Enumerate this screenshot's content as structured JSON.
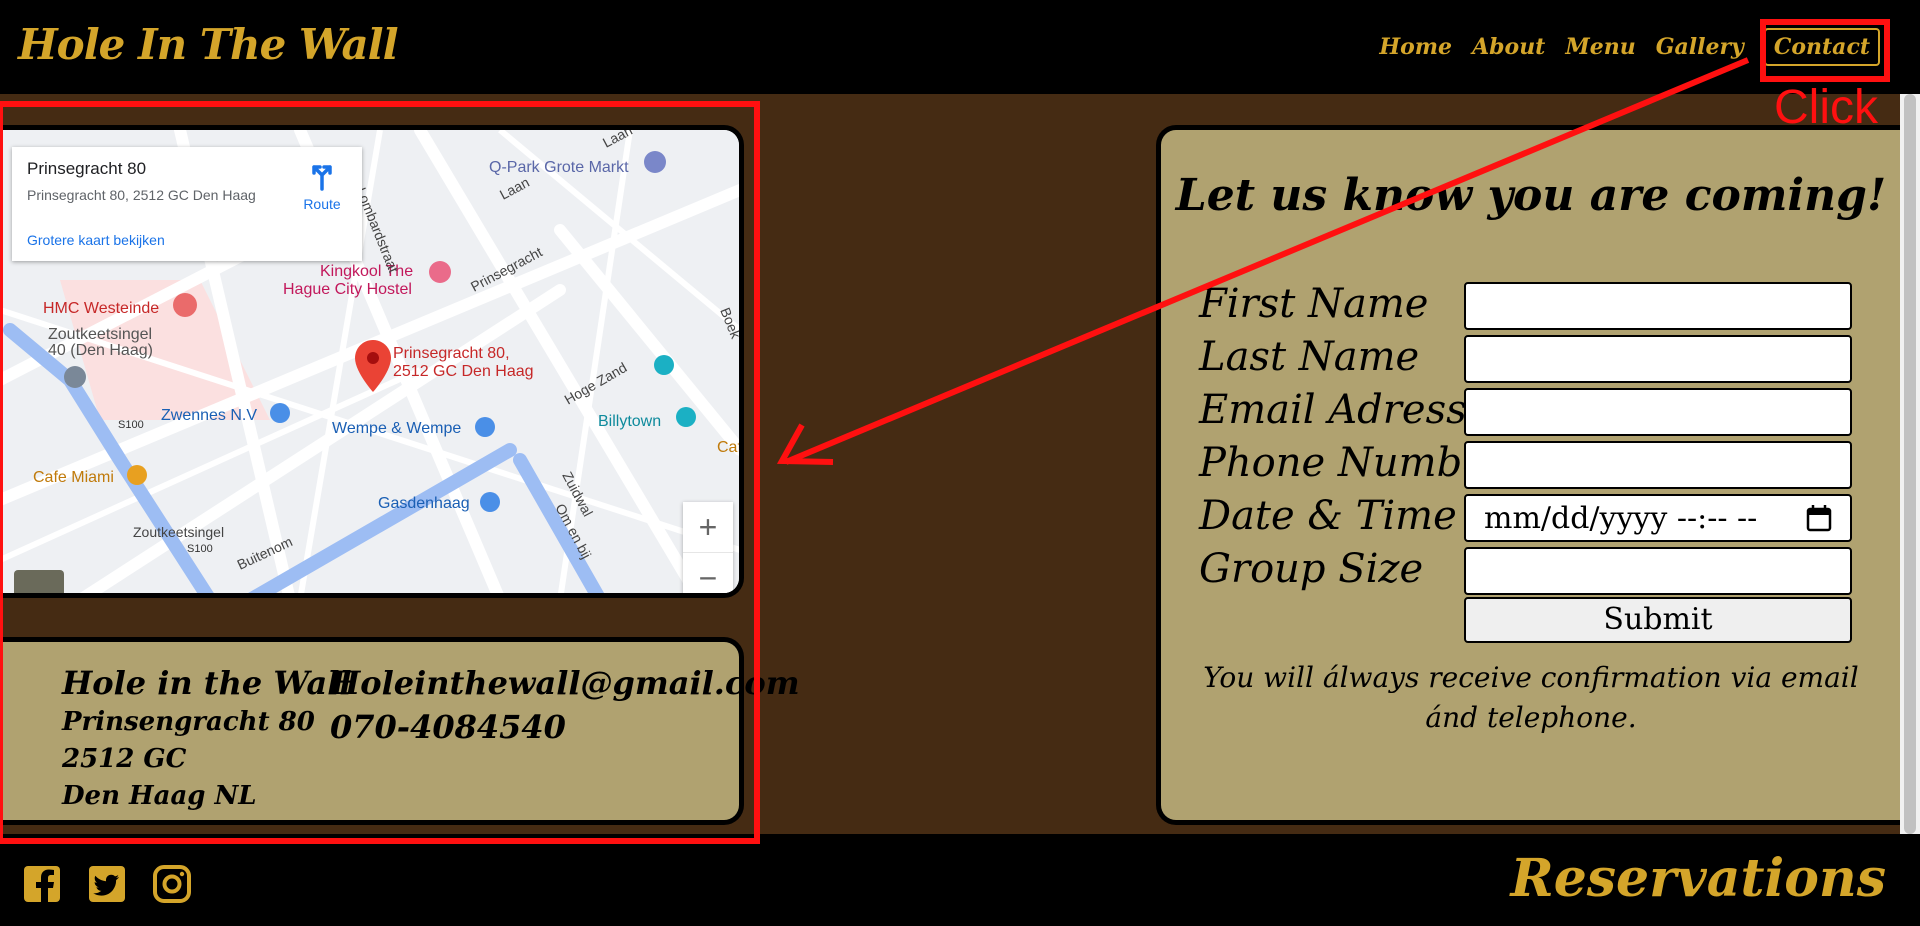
{
  "header": {
    "logo": "Hole In The Wall",
    "nav": [
      "Home",
      "About",
      "Menu",
      "Gallery",
      "Contact"
    ]
  },
  "map": {
    "place_title": "Prinsegracht 80",
    "place_address": "Prinsegracht 80, 2512 GC Den Haag",
    "larger_map_link": "Grotere kaart bekijken",
    "route_label": "Route",
    "pin_label_1": "Prinsegracht 80,",
    "pin_label_2": "2512 GC Den Haag",
    "labels": {
      "qpark": "Q-Park Grote Markt",
      "kingkool_1": "Kingkool The",
      "kingkool_2": "Hague City Hostel",
      "hmc": "HMC Westeinde",
      "zoutkeet_1": "Zoutkeetsingel",
      "zoutkeet_2": "40 (Den Haag)",
      "zwennes": "Zwennes N.V",
      "wempe": "Wempe & Wempe",
      "billytown": "Billytown",
      "cafe_miami": "Cafe Miami",
      "gasdenhaag": "Gasdenhaag",
      "zoutkeetsingel": "Zoutkeetsingel",
      "prinsegracht": "Prinsegracht",
      "hoge_zand": "Hoge Zand",
      "zuidwal": "Zuidwal",
      "om_en_bij": "Om en bij",
      "buitenom": "Buitenom",
      "lombardstraat": "Lombardstraat",
      "laan": "Laan",
      "laan2": "Laan",
      "s100a": "S100",
      "s100b": "S100",
      "cafe": "Caf",
      "boek": "Boek"
    },
    "zoom_in": "+",
    "zoom_out": "−"
  },
  "address": {
    "name": "Hole in the Wall",
    "street": "Prinsengracht 80",
    "postal": "2512 GC",
    "city": "Den Haag NL",
    "email": "Holeinthewall@gmail.com",
    "phone": "070-4084540"
  },
  "form": {
    "title": "Let us know you are coming!",
    "first_name": "First Name",
    "last_name": "Last Name",
    "email": "Email Adress",
    "phone": "Phone Number",
    "datetime": "Date & Time",
    "datetime_placeholder": "mm/dd/yyyy --:-- --",
    "group_size": "Group Size",
    "submit": "Submit",
    "note": "You will álways receive confirmation via email ánd telephone."
  },
  "footer": {
    "reservations": "Reservations",
    "social_icons": [
      "facebook-icon",
      "twitter-icon",
      "instagram-icon"
    ]
  },
  "annotation": {
    "click_label": "Click",
    "color": "#ff1010"
  },
  "colors": {
    "gold": "#d4a52a",
    "brown": "#452b13",
    "card": "#b0a270"
  }
}
